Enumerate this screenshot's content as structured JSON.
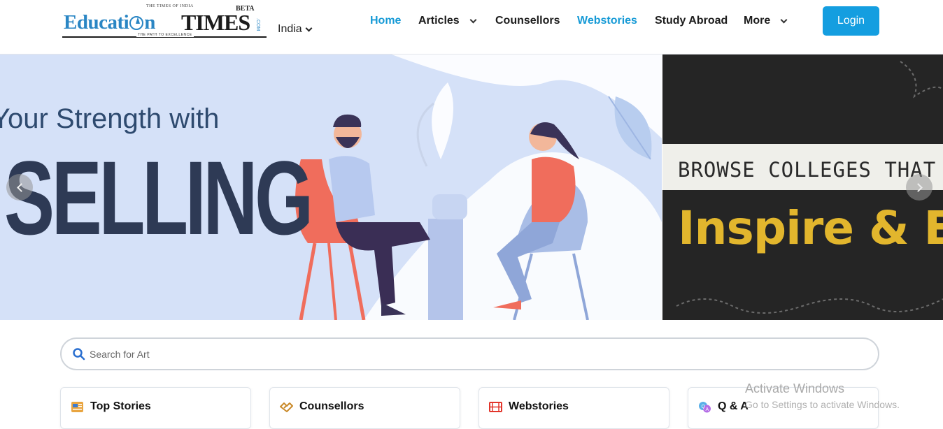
{
  "header": {
    "logo": {
      "top_mark": "THE TIMES OF INDIA",
      "word_left": "Educati",
      "word_mid": "n",
      "word_right": "TIMES",
      "beta": "BETA",
      "com": ".COM",
      "tagline": "THE PATH TO EXCELLENCE"
    },
    "region": "India",
    "nav": [
      {
        "label": "Home",
        "active": true
      },
      {
        "label": "Articles",
        "dropdown": true
      },
      {
        "label": "Counsellors"
      },
      {
        "label": "Webstories",
        "active": true
      },
      {
        "label": "Study Abroad"
      },
      {
        "label": "More",
        "dropdown": true
      }
    ],
    "login_label": "Login"
  },
  "carousel": {
    "slide1": {
      "line1": "Your Strength with",
      "line2": "SELLING"
    },
    "slide2": {
      "line1": "BROWSE COLLEGES THAT",
      "line2": "Inspire & En"
    }
  },
  "search": {
    "placeholder": "Search for Art"
  },
  "categories": [
    {
      "label": "Top Stories",
      "icon": "news-icon"
    },
    {
      "label": "Counsellors",
      "icon": "handshake-icon"
    },
    {
      "label": "Webstories",
      "icon": "film-icon"
    },
    {
      "label": "Q & A",
      "icon": "chat-bubbles-icon"
    }
  ],
  "watermark": {
    "line1": "Activate Windows",
    "line2": "Go to Settings to activate Windows."
  },
  "colors": {
    "accent": "#149ee0",
    "active_nav": "#169ad6",
    "logo_blue": "#2a86c4"
  }
}
